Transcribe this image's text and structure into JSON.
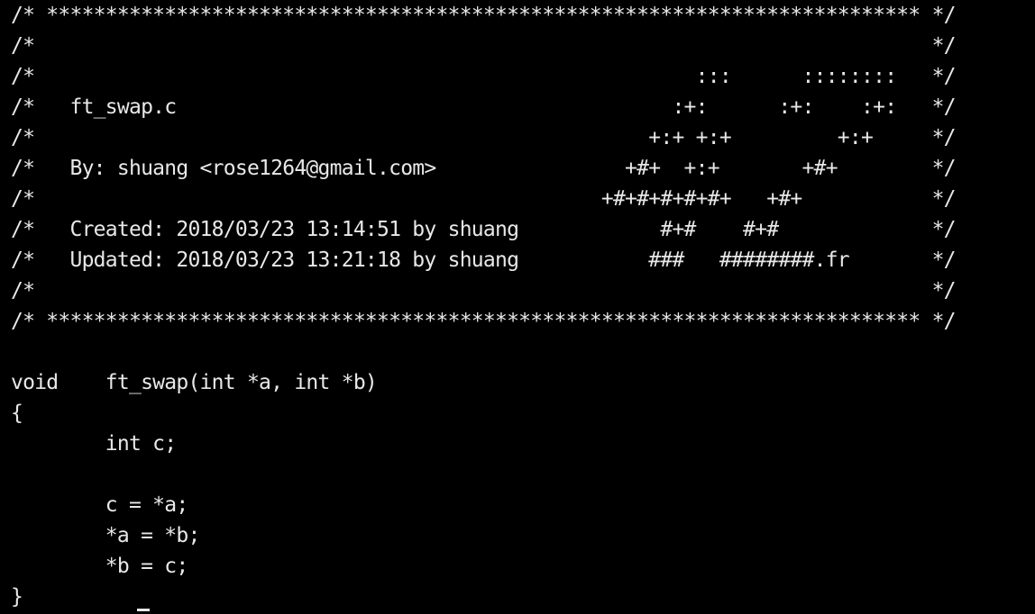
{
  "editor": {
    "lines": [
      "/* ************************************************************************** */",
      "/*                                                                            */",
      "/*                                                        :::      ::::::::   */",
      "/*   ft_swap.c                                          :+:      :+:    :+:   */",
      "/*                                                    +:+ +:+         +:+     */",
      "/*   By: shuang <rose1264@gmail.com>                +#+  +:+       +#+        */",
      "/*                                                +#+#+#+#+#+   +#+           */",
      "/*   Created: 2018/03/23 13:14:51 by shuang            #+#    #+#             */",
      "/*   Updated: 2018/03/23 13:21:18 by shuang           ###   ########.fr       */",
      "/*                                                                            */",
      "/* ************************************************************************** */",
      "",
      "void\tft_swap(int *a, int *b)",
      "{",
      "\tint c;",
      "",
      "\tc = *a;",
      "\t*a = *b;",
      "\t*b = c;",
      "}"
    ]
  }
}
